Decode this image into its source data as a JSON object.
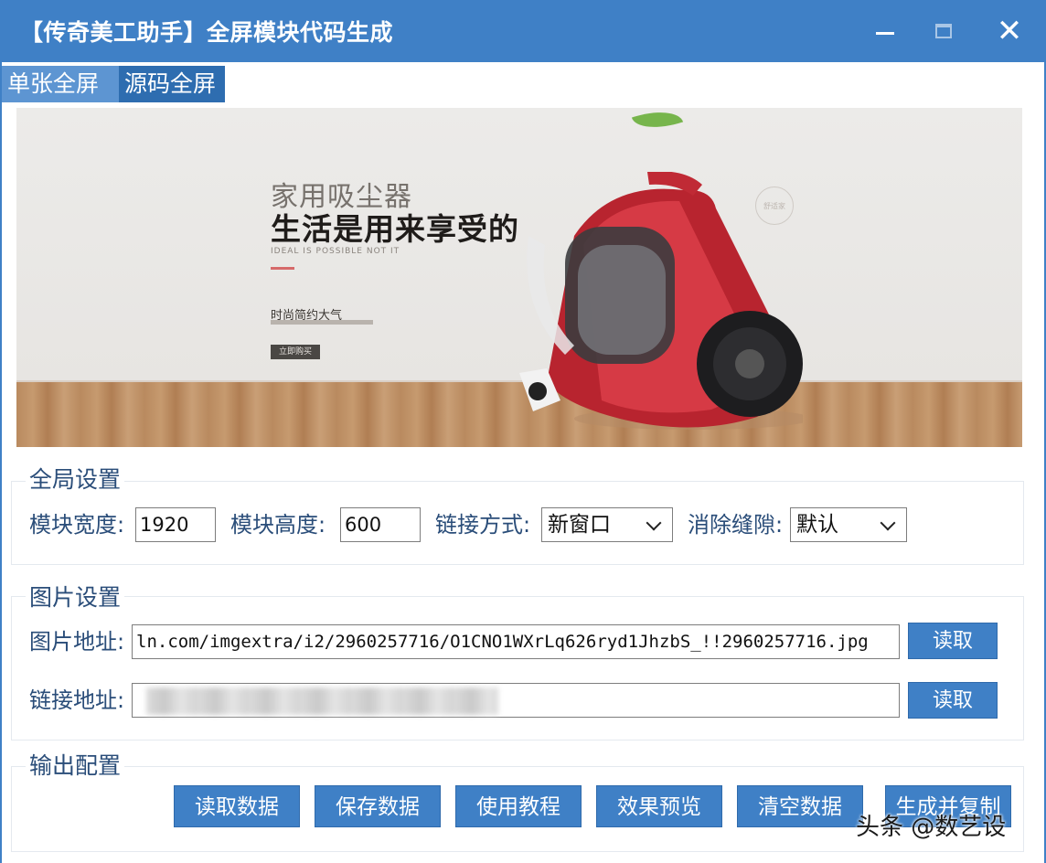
{
  "window": {
    "title": "【传奇美工助手】全屏模块代码生成"
  },
  "tabs": [
    {
      "label": "单张全屏",
      "active": true
    },
    {
      "label": "源码全屏",
      "active": false
    }
  ],
  "banner": {
    "category": "家用吸尘器",
    "headline": "生活是用来享受的",
    "subline": "IDEAL IS POSSIBLE NOT IT",
    "small_text": "时尚简约大气",
    "button": "立即购买",
    "stamp": "舒适家"
  },
  "global_settings": {
    "legend": "全局设置",
    "width_label": "模块宽度:",
    "width_value": "1920",
    "height_label": "模块高度:",
    "height_value": "600",
    "link_mode_label": "链接方式:",
    "link_mode_value": "新窗口",
    "gap_label": "消除缝隙:",
    "gap_value": "默认"
  },
  "image_settings": {
    "legend": "图片设置",
    "image_url_label": "图片地址:",
    "image_url_value": "ln.com/imgextra/i2/2960257716/O1CNO1WXrLq626ryd1JhzbS_!!2960257716.jpg",
    "link_url_label": "链接地址:",
    "read_label": "读取"
  },
  "output_config": {
    "legend": "输出配置",
    "buttons": [
      "读取数据",
      "保存数据",
      "使用教程",
      "效果预览",
      "清空数据",
      "生成并复制"
    ]
  },
  "watermark": "头条 @数艺设",
  "colors": {
    "titlebar": "#3f80c6",
    "accent": "#3f80c6",
    "label_text": "#2a4d79"
  }
}
